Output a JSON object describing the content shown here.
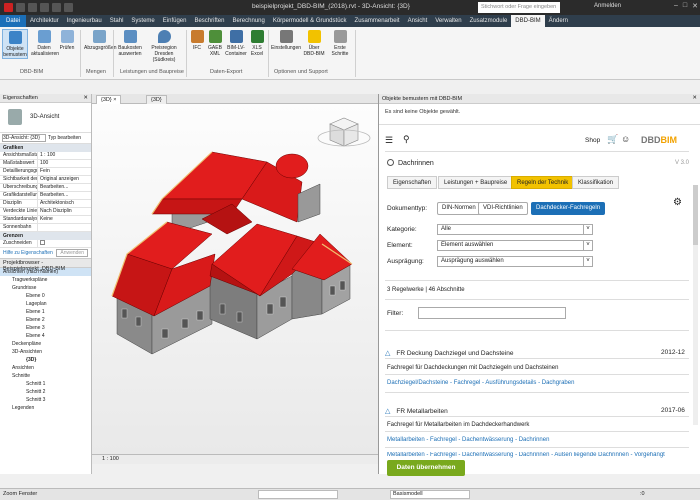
{
  "window": {
    "title": "beispielprojekt_DBD-BIM_(2018).rvt - 3D-Ansicht: {3D}",
    "search_placeholder": "Stichwort oder Frage eingeben",
    "user": "Anmelden"
  },
  "menu": {
    "file": "Datei",
    "items": [
      "Architektur",
      "Ingenieurbau",
      "Stahl",
      "Systeme",
      "Einfügen",
      "Beschriften",
      "Berechnung",
      "Körpermodell & Grundstück",
      "Zusammenarbeit",
      "Ansicht",
      "Verwalten",
      "Zusatzmodule",
      "DBD-BIM",
      "Ändern"
    ]
  },
  "ribbon": {
    "buttons": [
      {
        "label": "Objekte bemustern"
      },
      {
        "label": "Daten aktualisieren"
      },
      {
        "label": "Prüfen"
      },
      {
        "label": "Abzugsgrößen"
      },
      {
        "label": "Baukosten auswerten"
      },
      {
        "label": "Preisregion Dresden (Südkreis)"
      },
      {
        "label": "IFC"
      },
      {
        "label": "GAEB XML"
      },
      {
        "label": "BIM-LV-Container"
      },
      {
        "label": "XLS Excel"
      },
      {
        "label": "Einstellungen"
      },
      {
        "label": "Über DBD-BIM"
      },
      {
        "label": "Erste Schritte"
      }
    ],
    "groups": [
      "DBD-BIM",
      "Mengen",
      "Leistungen und Baupreise",
      "Daten-Export",
      "Optionen und Support"
    ]
  },
  "properties": {
    "title": "Eigenschaften",
    "type_name": "3D-Ansicht",
    "view_select": "3D-Ansicht: {3D}",
    "edit_type": "Typ bearbeiten",
    "section_graphics": "Grafiken",
    "rows": [
      {
        "k": "Ansichtsmaßstab",
        "v": "1 : 100"
      },
      {
        "k": "Maßstabswert",
        "v": "100"
      },
      {
        "k": "Detaillierungsgrad",
        "v": "Fein"
      },
      {
        "k": "Sichtbarkeit der Teile",
        "v": "Original anzeigen"
      },
      {
        "k": "Überschreibungen",
        "v": "Bearbeiten..."
      },
      {
        "k": "Grafikdarstellung",
        "v": "Bearbeiten..."
      },
      {
        "k": "Disziplin",
        "v": "Architektonisch"
      },
      {
        "k": "Verdeckte Linien",
        "v": "Nach Disziplin"
      },
      {
        "k": "Standardanalyse",
        "v": "Keine"
      },
      {
        "k": "Sonnenbahn",
        "v": ""
      }
    ],
    "section_bounds": "Grenzen",
    "crop_row": "Zuschneiden",
    "help_link": "Hilfe zu Eigenschaften",
    "apply": "Anwenden"
  },
  "browser": {
    "title": "Projektbrowser - Beispielprojekt_DBD-BIM",
    "items": [
      "Ansichten (nach Namen)",
      "Tragwerkspläne",
      "Grundrisse",
      "Ebene 0",
      "Lageplan",
      "Ebene 1",
      "Ebene 2",
      "Ebene 3",
      "Ebene 4",
      "Deckenpläne",
      "3D-Ansichten",
      "{3D}",
      "Ansichten",
      "Schnitte",
      "Schnitt 1",
      "Schnitt 2",
      "Schnitt 3",
      "Legenden"
    ]
  },
  "view": {
    "tab1": "{3D}",
    "tab2": "{3D}",
    "scale": "1 : 100",
    "cube_label": "VORNE"
  },
  "dbd": {
    "panel_title": "Objekte bemustern mit DBD-BIM",
    "no_objects": "Es sind keine Objekte gewählt.",
    "shop": "Shop",
    "logo_a": "DBD",
    "logo_b": "BIM",
    "category_title": "Dachrinnen",
    "version": "V 3.0",
    "tabs": [
      "Eigenschaften",
      "Leistungen + Baupreise",
      "Regeln der Technik",
      "Klassifikation"
    ],
    "doctype_label": "Dokumenttyp:",
    "doctype_buttons": [
      "DIN-Normen",
      "VDI-Richtlinien",
      "Dachdecker-Fachregeln"
    ],
    "fields": [
      {
        "label": "Kategorie:",
        "value": "Alle"
      },
      {
        "label": "Element:",
        "value": "Element auswählen"
      },
      {
        "label": "Ausprägung:",
        "value": "Ausprägung auswählen"
      }
    ],
    "count": "3 Regelwerke | 46 Abschnitte",
    "filter_label": "Filter:",
    "sections": [
      {
        "title": "FR Deckung Dachziegel und Dachsteine",
        "year": "2012-12",
        "desc": "Fachregel für Dachdeckungen mit Dachziegeln und Dachsteinen",
        "links": [
          "Dachziegel/Dachsteine - Fachregel - Ausführungsdetails - Dachgraben"
        ]
      },
      {
        "title": "FR Metallarbeiten",
        "year": "2017-06",
        "desc": "Fachregel für Metallarbeiten im Dachdeckerhandwerk",
        "links": [
          "Metallarbeiten - Fachregel - Dachentwässerung - Dachrinnen",
          "Metallarbeiten - Fachregel - Dachentwässerung - Dachrinnen - Außen liegende Dachrinnen - Vorgehängt"
        ]
      }
    ],
    "accept_button": "Daten übernehmen",
    "colors": {
      "accent": "#1c6fb6",
      "tab_active": "#f2c200",
      "accept": "#79a91d",
      "roof": "#e11d1d"
    }
  },
  "status": {
    "left": "Zoom Fenster",
    "model": "Basismodell",
    "zero": ":0"
  }
}
